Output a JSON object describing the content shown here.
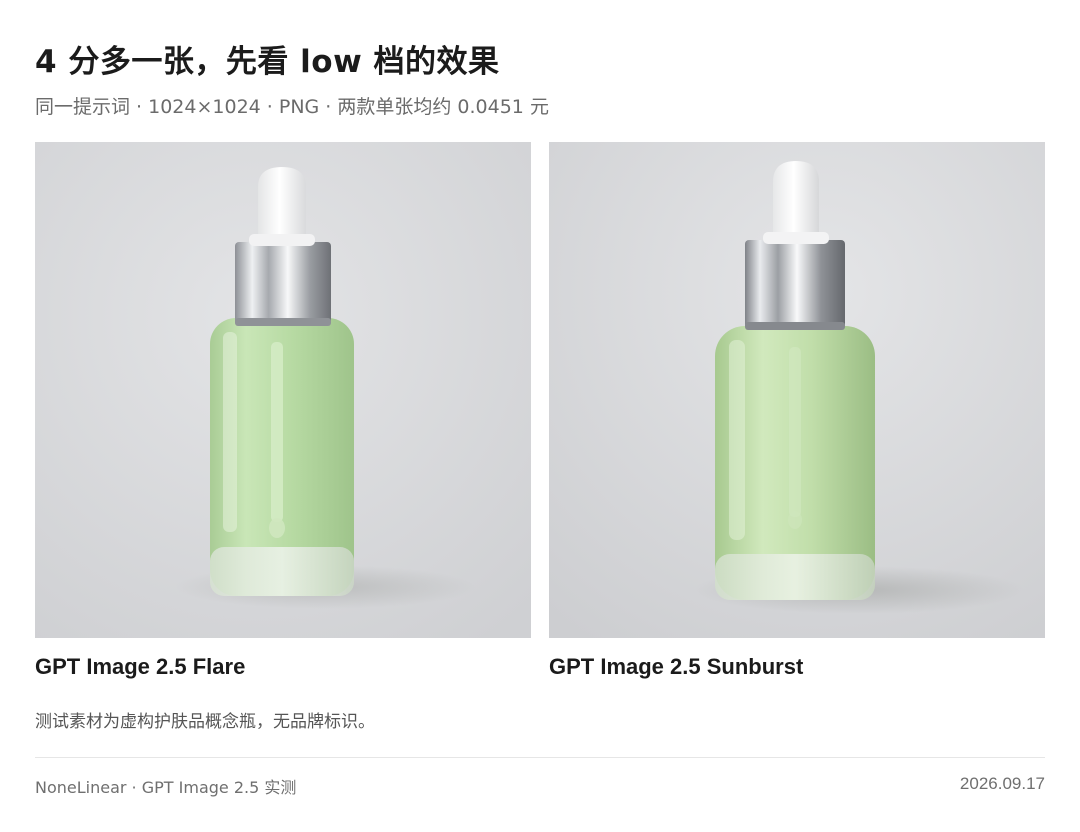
{
  "header": {
    "title": "4 分多一张，先看 low 档的效果",
    "subtitle": "同一提示词 · 1024×1024 · PNG · 两款单张均约 0.0451 元"
  },
  "images": [
    {
      "caption": "GPT Image 2.5 Flare",
      "icon": "dropper-bottle-product-photo"
    },
    {
      "caption": "GPT Image 2.5 Sunburst",
      "icon": "dropper-bottle-product-photo"
    }
  ],
  "note": "测试素材为虚构护肤品概念瓶，无品牌标识。",
  "footer": {
    "left": "NoneLinear · GPT Image 2.5 实测",
    "date": "2026.09.17"
  },
  "colors": {
    "background": "#ffffff",
    "photo_backdrop": "#dedfe1",
    "liquid": "#b9dca3",
    "text_primary": "#1b1b1b",
    "text_secondary": "#6b6b6b"
  }
}
